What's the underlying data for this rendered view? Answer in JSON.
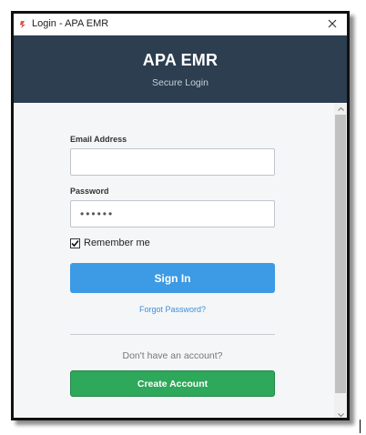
{
  "window": {
    "title": "Login - APA EMR",
    "icon": "app-icon",
    "close_icon": "close-icon"
  },
  "header": {
    "title": "APA EMR",
    "subtitle": "Secure Login",
    "background": "#2c3e50"
  },
  "form": {
    "email_label": "Email Address",
    "email_value": "",
    "password_label": "Password",
    "password_value": "••••••",
    "remember_label": "Remember me",
    "remember_checked": true,
    "sign_in_label": "Sign In",
    "forgot_label": "Forgot Password?",
    "no_account_text": "Don't have an account?",
    "create_account_label": "Create Account"
  },
  "colors": {
    "sign_in": "#3d9ae4",
    "create_account": "#2ea85a",
    "link": "#3d8fd6"
  }
}
